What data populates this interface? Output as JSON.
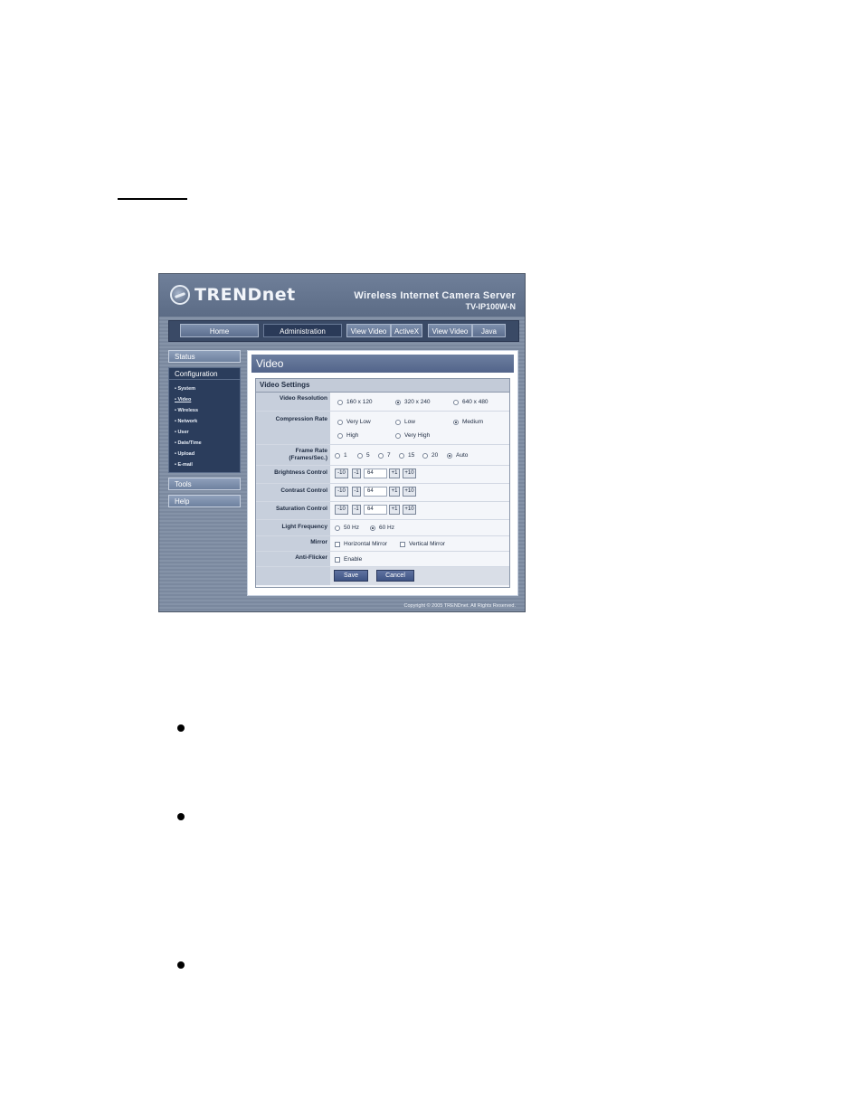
{
  "brand": {
    "logo_text": "TRENDnet",
    "product_name": "Wireless Internet Camera Server",
    "model": "TV-IP100W-N"
  },
  "nav": {
    "home": "Home",
    "administration": "Administration",
    "view_video_1": "View Video",
    "activex": "ActiveX",
    "view_video_2": "View Video",
    "java": "Java"
  },
  "sidebar": {
    "status": "Status",
    "configuration": "Configuration",
    "items": [
      "• System",
      "• Video",
      "• Wireless",
      "• Network",
      "• User",
      "• Date/Time",
      "• Upload",
      "• E-mail"
    ],
    "tools": "Tools",
    "help": "Help"
  },
  "page": {
    "title": "Video",
    "section": "Video Settings"
  },
  "settings": {
    "video_resolution": {
      "label": "Video Resolution",
      "options": [
        "160 x 120",
        "320 x 240",
        "640 x 480"
      ],
      "selected": "320 x 240"
    },
    "compression_rate": {
      "label": "Compression Rate",
      "options": [
        "Very Low",
        "Low",
        "Medium",
        "High",
        "Very High"
      ],
      "selected": "Medium"
    },
    "frame_rate": {
      "label_line1": "Frame Rate",
      "label_line2": "(Frames/Sec.)",
      "options": [
        "1",
        "5",
        "7",
        "15",
        "20",
        "Auto"
      ],
      "selected": "Auto"
    },
    "brightness": {
      "label": "Brightness Control",
      "value": "64"
    },
    "contrast": {
      "label": "Contrast Control",
      "value": "64"
    },
    "saturation": {
      "label": "Saturation Control",
      "value": "64"
    },
    "step_buttons": {
      "minus10": "-10",
      "minus1": "-1",
      "plus1": "+1",
      "plus10": "+10"
    },
    "light_frequency": {
      "label": "Light Frequency",
      "options": [
        "50 Hz",
        "60 Hz"
      ],
      "selected": "60 Hz"
    },
    "mirror": {
      "label": "Mirror",
      "horizontal": "Horizontal Mirror",
      "vertical": "Vertical Mirror"
    },
    "anti_flicker": {
      "label": "Anti-Flicker",
      "enable": "Enable"
    }
  },
  "actions": {
    "save": "Save",
    "cancel": "Cancel"
  },
  "footer": {
    "copyright": "Copyright © 2005 TRENDnet. All Rights Reserved."
  }
}
